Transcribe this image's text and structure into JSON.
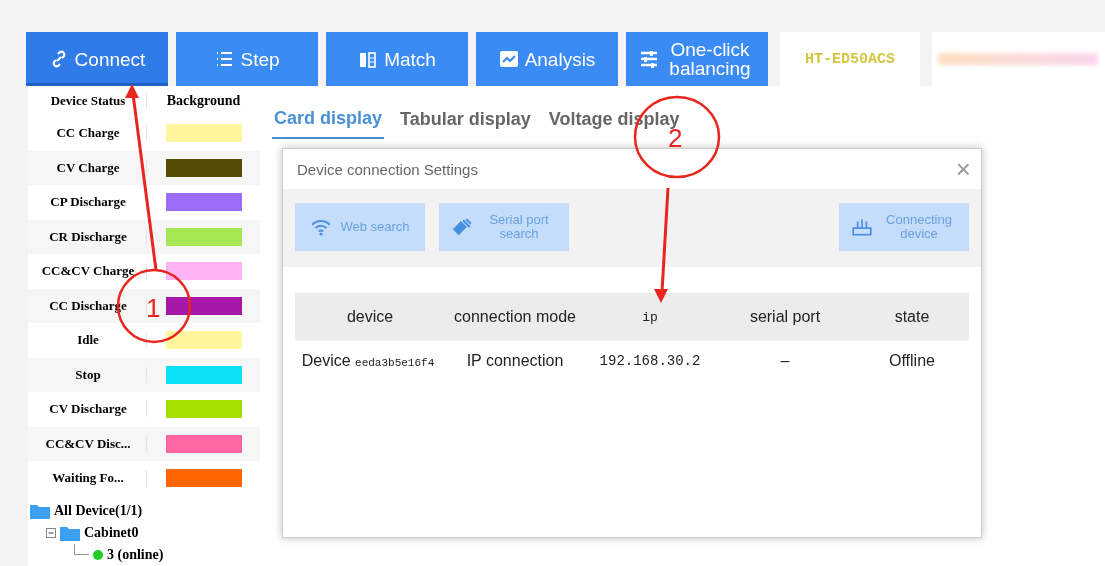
{
  "toolbar": [
    {
      "label": "Connect",
      "selected": true
    },
    {
      "label": "Step",
      "selected": false
    },
    {
      "label": "Match",
      "selected": false
    },
    {
      "label": "Analysis",
      "selected": false
    },
    {
      "label": "One-click balancing",
      "selected": false
    }
  ],
  "model": "HT-ED50ACS",
  "legend": {
    "columns": [
      "Device Status",
      "Background"
    ],
    "rows": [
      {
        "name": "CC Charge",
        "color": "#fff59d"
      },
      {
        "name": "CV Charge",
        "color": "#554a05"
      },
      {
        "name": "CP Discharge",
        "color": "#9b6cf5"
      },
      {
        "name": "CR Discharge",
        "color": "#a6e854"
      },
      {
        "name": "CC&CV Charge",
        "color": "#ffb3f5"
      },
      {
        "name": "CC Discharge",
        "color": "#a818a8"
      },
      {
        "name": "Idle",
        "color": "#fff59d"
      },
      {
        "name": "Stop",
        "color": "#08e0f5"
      },
      {
        "name": "CV Discharge",
        "color": "#a6e000"
      },
      {
        "name": "CC&CV Disc...",
        "color": "#ff66a3"
      },
      {
        "name": "Waiting Fo...",
        "color": "#ff6600"
      }
    ]
  },
  "tree": [
    {
      "label": "All Device(1/1)",
      "kind": "folder",
      "children": [
        {
          "label": "Cabinet0",
          "kind": "folder",
          "expanded": true,
          "children": [
            {
              "label": "3 (online)",
              "kind": "device",
              "color": "#22cc22"
            }
          ]
        }
      ]
    }
  ],
  "tabs": [
    {
      "label": "Card display",
      "selected": true
    },
    {
      "label": "Tabular display",
      "selected": false
    },
    {
      "label": "Voltage display",
      "selected": false
    }
  ],
  "dialog": {
    "title": "Device connection Settings",
    "close": "×",
    "buttons": [
      {
        "label": "Web search"
      },
      {
        "label": "Serial port search"
      },
      {
        "label": "Connecting device"
      }
    ],
    "columns": [
      "device",
      "connection mode",
      "ip",
      "serial port",
      "state"
    ],
    "rows": [
      {
        "device": "Device",
        "device_id": "eeda3b5e16f4",
        "mode": "IP connection",
        "ip": "192.168.30.2",
        "serial": "–",
        "state": "Offline"
      }
    ]
  },
  "annotations": [
    {
      "label": "1"
    },
    {
      "label": "2"
    }
  ]
}
